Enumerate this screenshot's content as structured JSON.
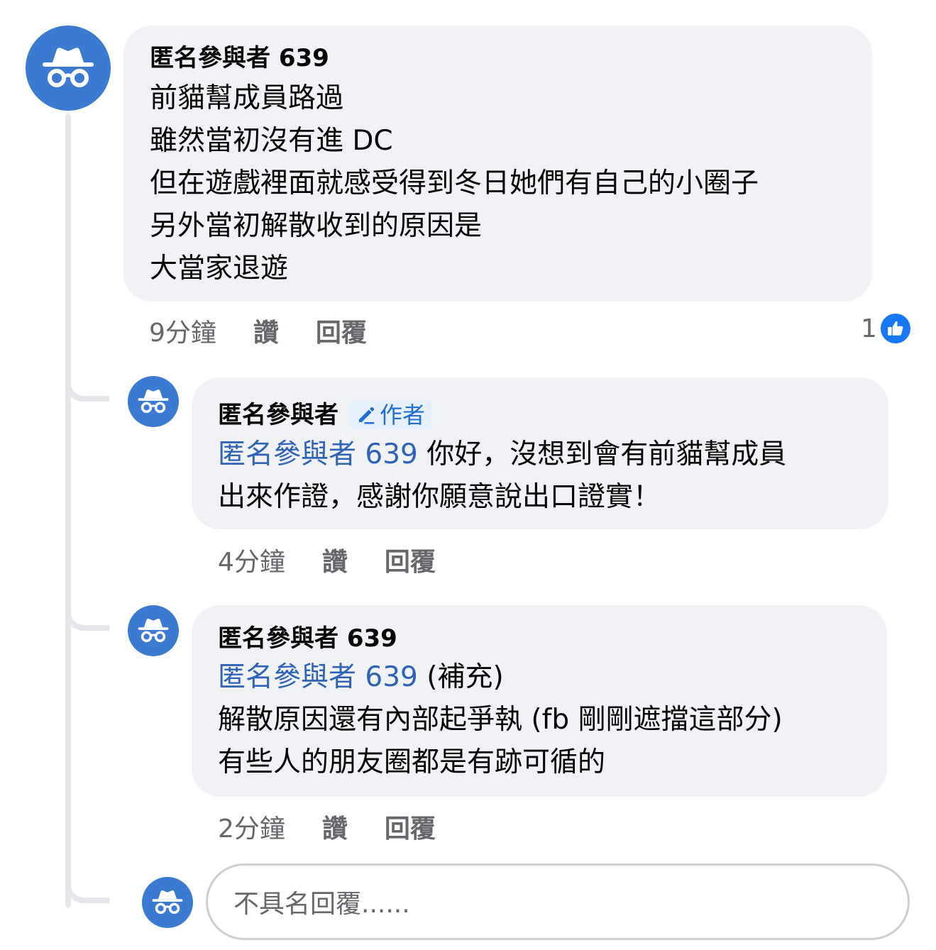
{
  "comments": [
    {
      "author": "匿名參與者 639",
      "lines": [
        "前貓幫成員路過",
        "雖然當初沒有進 DC",
        "但在遊戲裡面就感受得到冬日她們有自己的小圈子",
        "另外當初解散收到的原因是",
        "大當家退遊"
      ],
      "time": "9分鐘",
      "like_label": "讚",
      "reply_label": "回覆",
      "reaction_count": "1",
      "reaction_icon": "thumbs-up-icon"
    },
    {
      "author": "匿名參與者",
      "badge": "作者",
      "badge_icon": "pencil-icon",
      "mention": "匿名參與者 639",
      "line1_rest": " 你好，沒想到會有前貓幫成員",
      "line2": "出來作證，感謝你願意說出口證實！",
      "time": "4分鐘",
      "like_label": "讚",
      "reply_label": "回覆"
    },
    {
      "author": "匿名參與者 639",
      "mention": "匿名參與者 639",
      "line1_rest": " (補充)",
      "line2": "解散原因還有內部起爭執 (fb 剛剛遮擋這部分)",
      "line3": "有些人的朋友圈都是有跡可循的",
      "time": "2分鐘",
      "like_label": "讚",
      "reply_label": "回覆"
    }
  ],
  "reply_box": {
    "placeholder": "不具名回覆......"
  },
  "avatar_icon": "incognito-icon",
  "colors": {
    "avatar": "#3b7ad1",
    "mention": "#2e63b7",
    "bubble": "#f0f2f5",
    "like": "#1877f2"
  }
}
